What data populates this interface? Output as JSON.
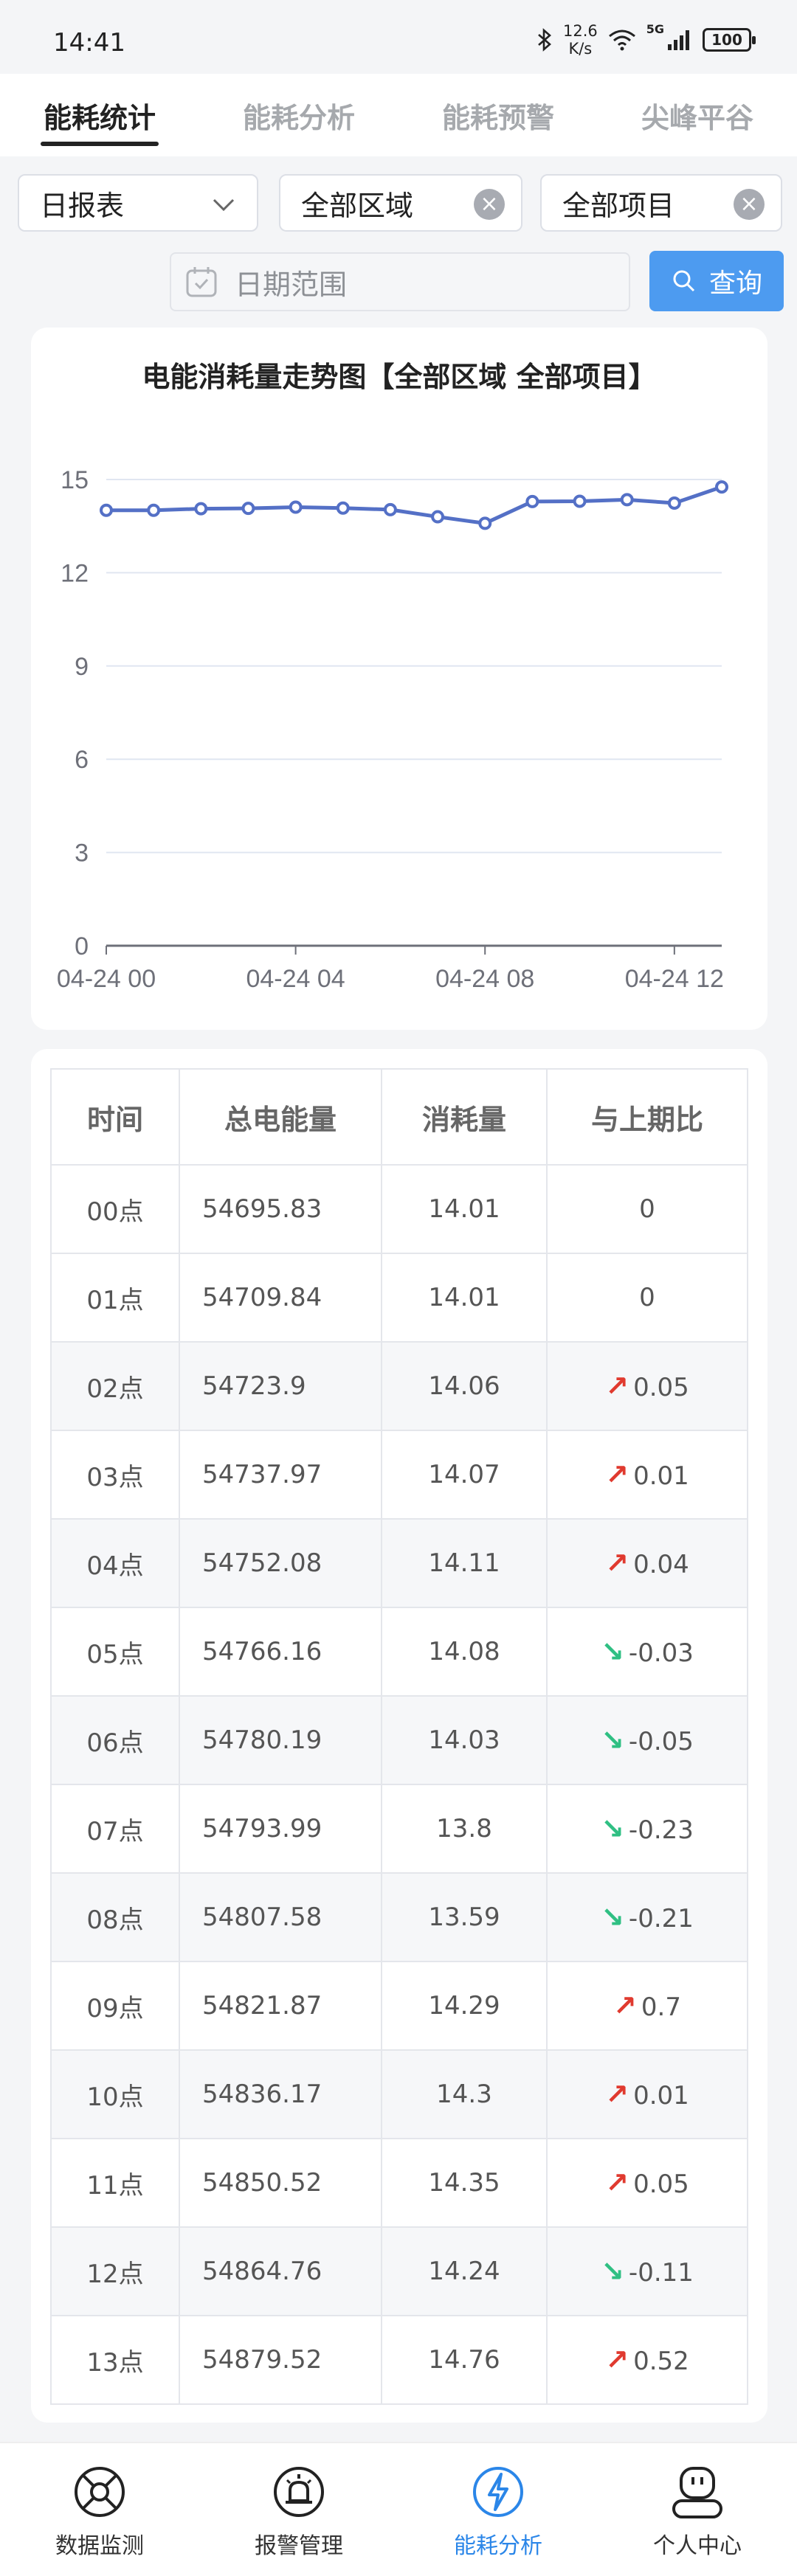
{
  "status": {
    "time": "14:41",
    "speed_value": "12.6",
    "speed_unit": "K/s",
    "network": "5G",
    "battery": "100"
  },
  "tabs": [
    {
      "label": "能耗统计",
      "active": true
    },
    {
      "label": "能耗分析",
      "active": false
    },
    {
      "label": "能耗预警",
      "active": false
    },
    {
      "label": "尖峰平谷",
      "active": false
    }
  ],
  "filters": {
    "report_type": "日报表",
    "area": "全部区域",
    "project": "全部项目",
    "date_placeholder": "日期范围",
    "query_label": "查询"
  },
  "chart_data": {
    "type": "line",
    "title": "电能消耗量走势图【全部区域 全部项目】",
    "x": [
      "04-24 00",
      "04-24 01",
      "04-24 02",
      "04-24 03",
      "04-24 04",
      "04-24 05",
      "04-24 06",
      "04-24 07",
      "04-24 08",
      "04-24 09",
      "04-24 10",
      "04-24 11",
      "04-24 12",
      "04-24 13"
    ],
    "x_tick_labels": [
      "04-24 00",
      "04-24 04",
      "04-24 08",
      "04-24 12"
    ],
    "series": [
      {
        "values": [
          14.01,
          14.01,
          14.06,
          14.07,
          14.11,
          14.08,
          14.03,
          13.8,
          13.59,
          14.29,
          14.3,
          14.35,
          14.24,
          14.76
        ]
      }
    ],
    "y_ticks": [
      0,
      3,
      6,
      9,
      12,
      15
    ],
    "ylim": [
      0,
      15
    ],
    "grid": true,
    "color": "#5470c6"
  },
  "table": {
    "headers": [
      "时间",
      "总电能量",
      "消耗量",
      "与上期比"
    ],
    "rows": [
      {
        "time": "00点",
        "total": "54695.83",
        "usage": "14.01",
        "change": "0",
        "trend": "none"
      },
      {
        "time": "01点",
        "total": "54709.84",
        "usage": "14.01",
        "change": "0",
        "trend": "none"
      },
      {
        "time": "02点",
        "total": "54723.9",
        "usage": "14.06",
        "change": "0.05",
        "trend": "up"
      },
      {
        "time": "03点",
        "total": "54737.97",
        "usage": "14.07",
        "change": "0.01",
        "trend": "up"
      },
      {
        "time": "04点",
        "total": "54752.08",
        "usage": "14.11",
        "change": "0.04",
        "trend": "up"
      },
      {
        "time": "05点",
        "total": "54766.16",
        "usage": "14.08",
        "change": "-0.03",
        "trend": "down"
      },
      {
        "time": "06点",
        "total": "54780.19",
        "usage": "14.03",
        "change": "-0.05",
        "trend": "down"
      },
      {
        "time": "07点",
        "total": "54793.99",
        "usage": "13.8",
        "change": "-0.23",
        "trend": "down"
      },
      {
        "time": "08点",
        "total": "54807.58",
        "usage": "13.59",
        "change": "-0.21",
        "trend": "down"
      },
      {
        "time": "09点",
        "total": "54821.87",
        "usage": "14.29",
        "change": "0.7",
        "trend": "up"
      },
      {
        "time": "10点",
        "total": "54836.17",
        "usage": "14.3",
        "change": "0.01",
        "trend": "up"
      },
      {
        "time": "11点",
        "total": "54850.52",
        "usage": "14.35",
        "change": "0.05",
        "trend": "up"
      },
      {
        "time": "12点",
        "total": "54864.76",
        "usage": "14.24",
        "change": "-0.11",
        "trend": "down"
      },
      {
        "time": "13点",
        "total": "54879.52",
        "usage": "14.76",
        "change": "0.52",
        "trend": "up"
      }
    ]
  },
  "nav": [
    {
      "label": "数据监测",
      "icon": "monitor-icon",
      "active": false
    },
    {
      "label": "报警管理",
      "icon": "alarm-icon",
      "active": false
    },
    {
      "label": "能耗分析",
      "icon": "lightning-icon",
      "active": true
    },
    {
      "label": "个人中心",
      "icon": "profile-icon",
      "active": false
    }
  ],
  "colors": {
    "accent": "#4d9bf0",
    "up": "#e03a2f",
    "down": "#2fbf83",
    "line": "#5470c6"
  }
}
